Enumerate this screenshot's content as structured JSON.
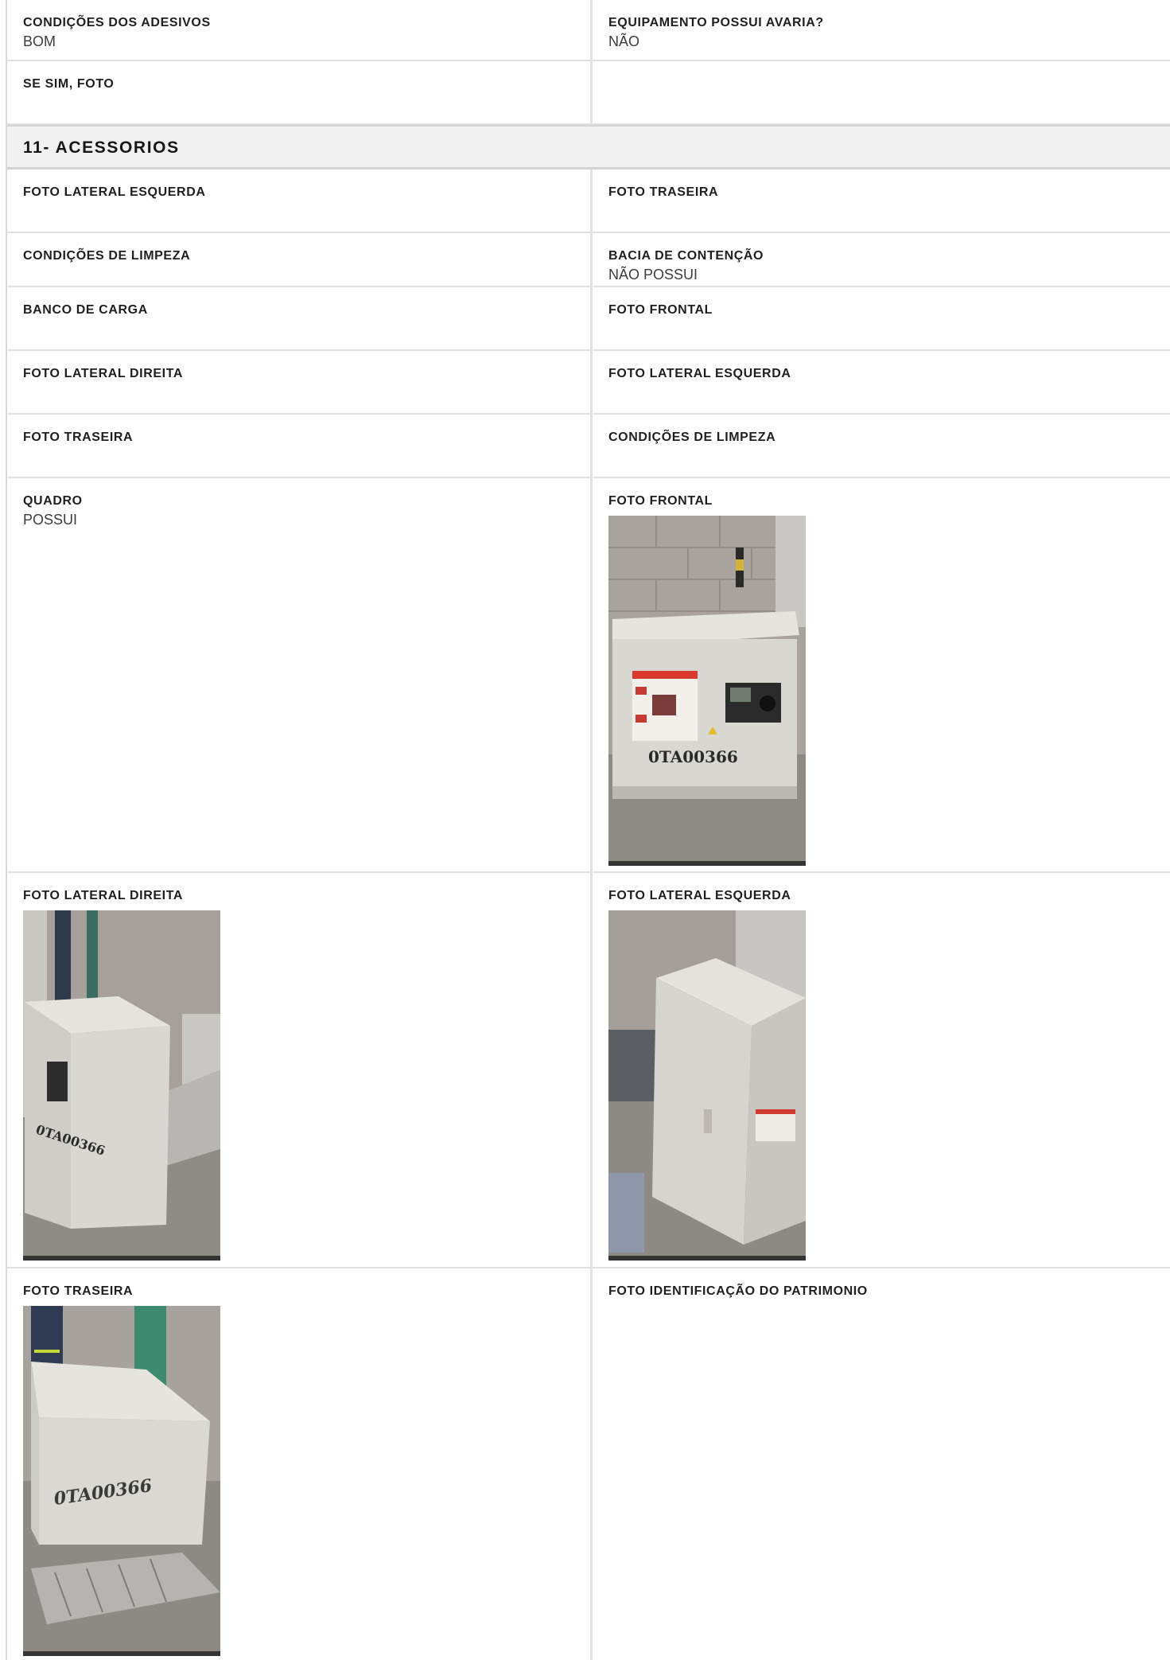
{
  "rows_top": [
    {
      "left": {
        "label": "CONDIÇÕES DOS ADESIVOS",
        "value": "BOM"
      },
      "right": {
        "label": "EQUIPAMENTO POSSUI AVARIA?",
        "value": "NÃO"
      }
    },
    {
      "left": {
        "label": "SE SIM, FOTO",
        "value": ""
      },
      "right": {
        "label": "",
        "value": ""
      }
    }
  ],
  "section": {
    "title": "11- ACESSORIOS"
  },
  "rows_section": [
    {
      "left": {
        "label": "FOTO LATERAL ESQUERDA",
        "value": ""
      },
      "right": {
        "label": "FOTO TRASEIRA",
        "value": ""
      }
    },
    {
      "left": {
        "label": "CONDIÇÕES DE LIMPEZA",
        "value": ""
      },
      "right": {
        "label": "BACIA DE CONTENÇÃO",
        "value": "NÃO POSSUI"
      }
    },
    {
      "left": {
        "label": "BANCO DE CARGA",
        "value": ""
      },
      "right": {
        "label": "FOTO FRONTAL",
        "value": ""
      }
    },
    {
      "left": {
        "label": "FOTO LATERAL DIREITA",
        "value": ""
      },
      "right": {
        "label": "FOTO LATERAL ESQUERDA",
        "value": ""
      }
    },
    {
      "left": {
        "label": "FOTO TRASEIRA",
        "value": ""
      },
      "right": {
        "label": "CONDIÇÕES DE LIMPEZA",
        "value": ""
      }
    },
    {
      "left": {
        "label": "QUADRO",
        "value": "POSSUI"
      },
      "right": {
        "label": "FOTO FRONTAL",
        "value": ""
      }
    },
    {
      "left": {
        "label": "FOTO LATERAL DIREITA",
        "value": ""
      },
      "right": {
        "label": "FOTO LATERAL ESQUERDA",
        "value": ""
      }
    },
    {
      "left": {
        "label": "FOTO TRASEIRA",
        "value": ""
      },
      "right": {
        "label": "FOTO IDENTIFICAÇÃO DO PATRIMONIO",
        "value": ""
      }
    }
  ],
  "photos": {
    "front_asset_code": "0TA00366",
    "left_side_marking": "0TA00366",
    "rear_marking": "0TA00366"
  },
  "colors": {
    "border": "#e1e1e1",
    "section_bg": "#f1f1f1",
    "cabinet": "#d9d7d2",
    "floor": "#8d8a85",
    "wall": "#a7a39c"
  }
}
